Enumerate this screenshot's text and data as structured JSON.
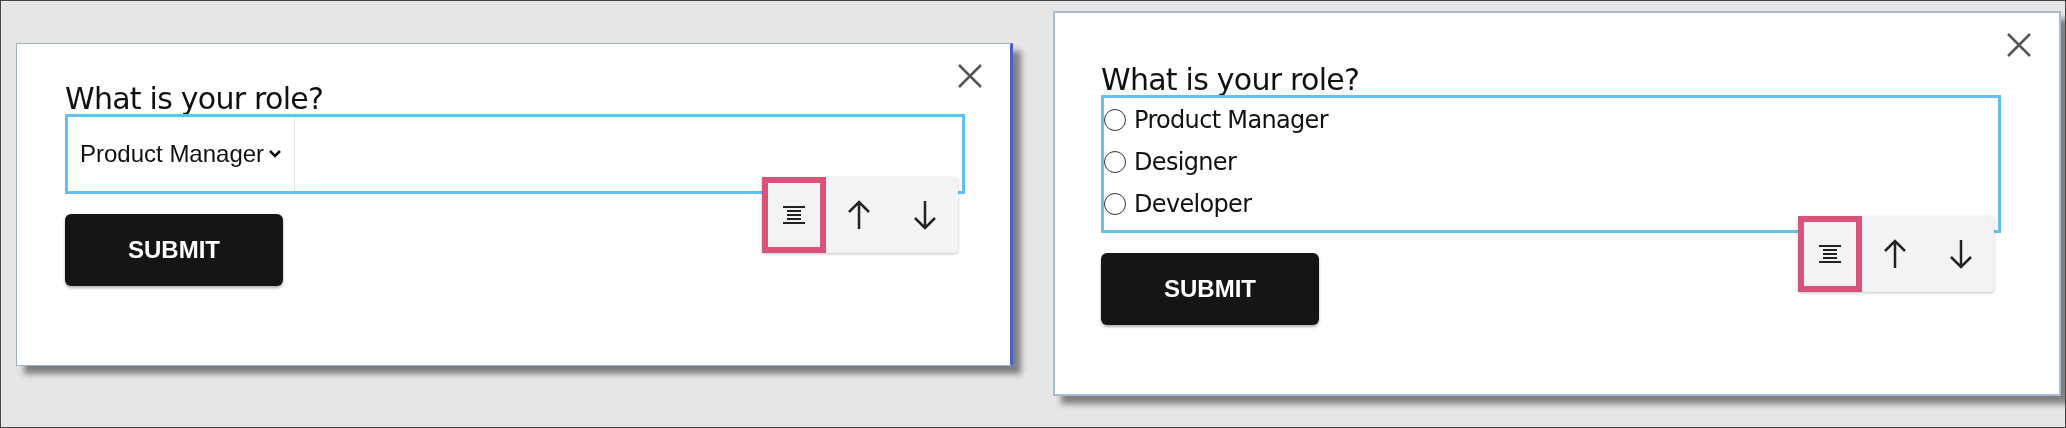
{
  "panels": [
    {
      "kind": "select",
      "question": "What is your role?",
      "value": "Product Manager",
      "submit": "SUBMIT",
      "tools": [
        {
          "kind": "align",
          "highlighted": true
        },
        {
          "kind": "up",
          "highlighted": false
        },
        {
          "kind": "down",
          "highlighted": false
        }
      ]
    },
    {
      "kind": "radio",
      "question": "What is your role?",
      "options": [
        {
          "label": "Product Manager",
          "selected": false
        },
        {
          "label": "Designer",
          "selected": false
        },
        {
          "label": "Developer",
          "selected": false
        }
      ],
      "submit": "SUBMIT",
      "tools": [
        {
          "kind": "align",
          "highlighted": true
        },
        {
          "kind": "up",
          "highlighted": false
        },
        {
          "kind": "down",
          "highlighted": false
        }
      ]
    }
  ]
}
